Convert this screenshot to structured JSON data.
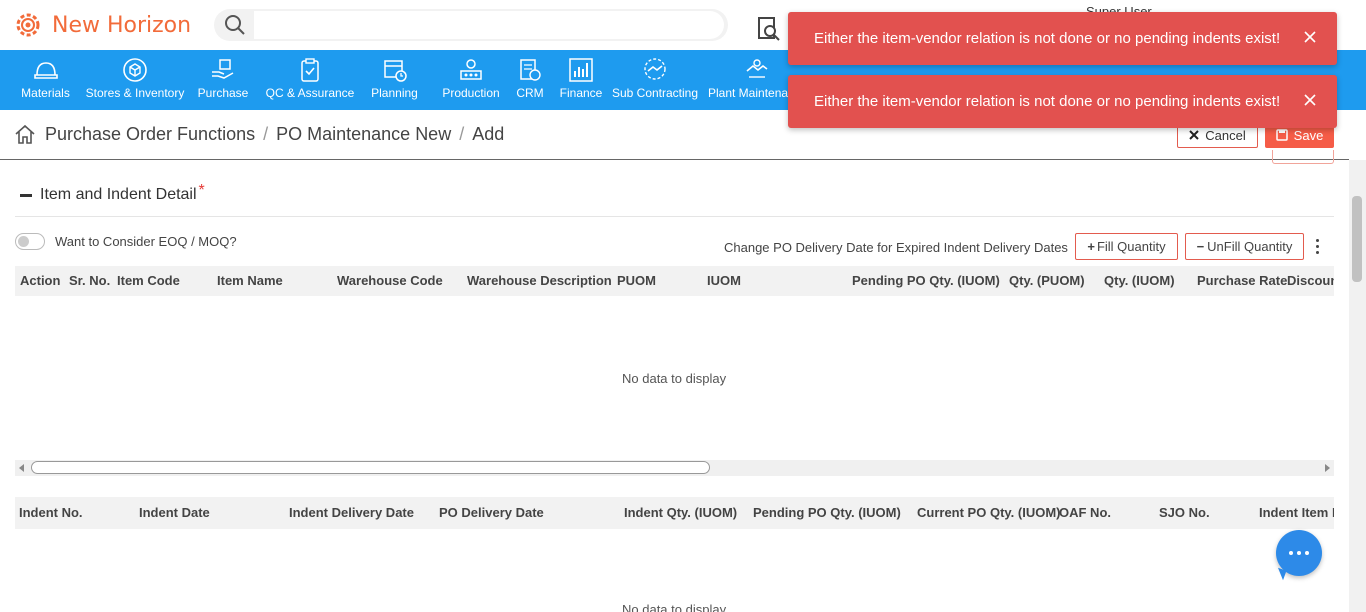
{
  "app": {
    "name": "New Horizon",
    "user": "Super User"
  },
  "search": {
    "placeholder": ""
  },
  "nav": {
    "items": [
      {
        "label": "Materials",
        "icon": "helmet-icon"
      },
      {
        "label": "Stores & Inventory",
        "icon": "cube-icon"
      },
      {
        "label": "Purchase",
        "icon": "hand-box-icon"
      },
      {
        "label": "QC & Assurance",
        "icon": "clipboard-check-icon"
      },
      {
        "label": "Planning",
        "icon": "calendar-clock-icon"
      },
      {
        "label": "Production",
        "icon": "factory-icon"
      },
      {
        "label": "CRM",
        "icon": "crm-icon"
      },
      {
        "label": "Finance",
        "icon": "bar-chart-icon"
      },
      {
        "label": "Sub Contracting",
        "icon": "handshake-icon"
      },
      {
        "label": "Plant Maintena",
        "icon": "plant-handshake-icon"
      }
    ]
  },
  "breadcrumb": {
    "items": [
      "Purchase Order Functions",
      "PO Maintenance New",
      "Add"
    ],
    "separator": "/"
  },
  "actions": {
    "cancel": "Cancel",
    "save": "Save"
  },
  "section": {
    "title": "Item and Indent Detail",
    "required_mark": "*"
  },
  "toggle": {
    "label": "Want to Consider EOQ / MOQ?",
    "on": false
  },
  "toolbar": {
    "change_date_label": "Change PO Delivery Date for Expired Indent Delivery Dates",
    "fill_quantity": "Fill Quantity",
    "unfill_quantity": "UnFill Quantity"
  },
  "item_grid": {
    "columns": [
      "Action",
      "Sr. No.",
      "Item Code",
      "Item Name",
      "Warehouse Code",
      "Warehouse Description",
      "PUOM",
      "IUOM",
      "Pending PO Qty. (IUOM)",
      "Qty. (PUOM)",
      "Qty. (IUOM)",
      "Purchase Rate",
      "Discoun"
    ],
    "empty_text": "No data to display"
  },
  "indent_grid": {
    "columns": [
      "Indent No.",
      "Indent Date",
      "Indent Delivery Date",
      "PO Delivery Date",
      "Indent Qty. (IUOM)",
      "Pending PO Qty. (IUOM)",
      "Current PO Qty. (IUOM)",
      "OAF No.",
      "SJO No.",
      "Indent Item R"
    ],
    "empty_text": "No data to display"
  },
  "toasts": [
    {
      "message": "Either the item-vendor relation is not done or no pending indents exist!"
    },
    {
      "message": "Either the item-vendor relation is not done or no pending indents exist!"
    }
  ],
  "colors": {
    "brand": "#f26b3a",
    "nav": "#1e9bef",
    "toast": "#e2514f",
    "accent": "#f55c47"
  }
}
